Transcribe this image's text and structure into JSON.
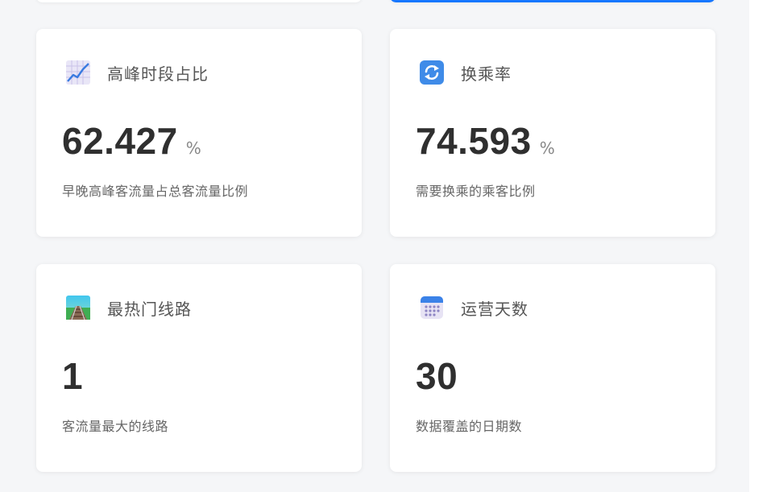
{
  "cards": [
    {
      "title": "高峰时段占比",
      "value": "62.427",
      "unit": "%",
      "description": "早晚高峰客流量占总客流量比例",
      "icon": "chart-increasing-icon"
    },
    {
      "title": "换乘率",
      "value": "74.593",
      "unit": "%",
      "description": "需要换乘的乘客比例",
      "icon": "arrows-cycle-icon"
    },
    {
      "title": "最热门线路",
      "value": "1",
      "unit": "",
      "description": "客流量最大的线路",
      "icon": "railway-track-icon"
    },
    {
      "title": "运营天数",
      "value": "30",
      "unit": "",
      "description": "数据覆盖的日期数",
      "icon": "calendar-icon"
    }
  ],
  "colors": {
    "panel_background": "#f5f6f8",
    "card_background": "#ffffff",
    "accent": "#1677ff",
    "value_text": "#2f2f2f",
    "label_text": "#555555"
  }
}
